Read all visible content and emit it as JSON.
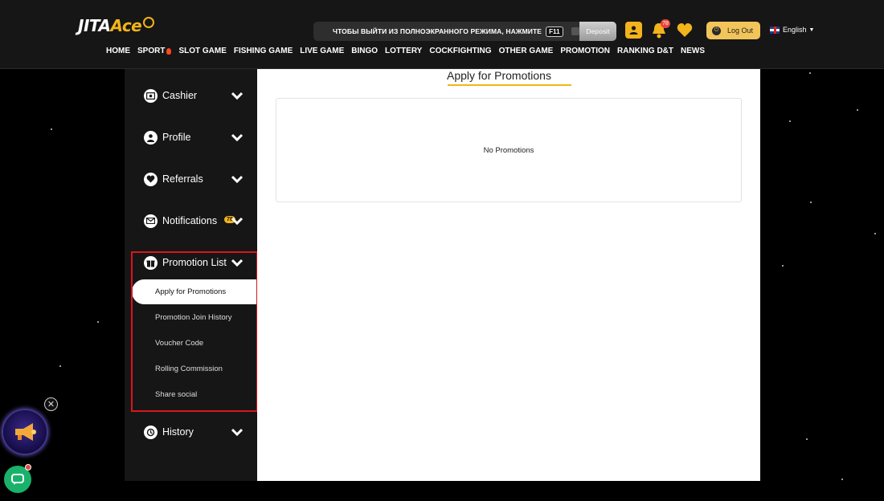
{
  "logo": {
    "part1": "JITA",
    "part2": "Ace"
  },
  "fullscreen_banner": {
    "text": "ЧТОБЫ ВЫЙТИ ИЗ ПОЛНОЭКРАННОГО РЕЖИМА, НАЖМИТЕ",
    "key": "F11",
    "deposit_label": "Deposit"
  },
  "header": {
    "notification_count": "78",
    "logout_label": "Log Out",
    "language": "English"
  },
  "nav": {
    "items": [
      "HOME",
      "SPORT",
      "SLOT GAME",
      "FISHING GAME",
      "LIVE GAME",
      "BINGO",
      "LOTTERY",
      "COCKFIGHTING",
      "OTHER GAME",
      "PROMOTION",
      "RANKING D&T",
      "NEWS"
    ]
  },
  "sidebar": {
    "items": [
      {
        "label": "Cashier",
        "icon": "cashier-icon"
      },
      {
        "label": "Profile",
        "icon": "user-icon"
      },
      {
        "label": "Referrals",
        "icon": "heart-icon"
      },
      {
        "label": "Notifications",
        "icon": "mail-icon",
        "badge": "78"
      },
      {
        "label": "Promotion List",
        "icon": "gift-icon"
      },
      {
        "label": "History",
        "icon": "history-icon"
      }
    ],
    "promotion_sub": [
      "Apply for Promotions",
      "Promotion Join History",
      "Voucher Code",
      "Rolling Commission",
      "Share social"
    ]
  },
  "main": {
    "title": "Apply for Promotions",
    "empty_text": "No Promotions"
  },
  "colors": {
    "accent": "#f2b31c",
    "highlight_border": "#d9161c",
    "chat": "#1ab26b"
  }
}
